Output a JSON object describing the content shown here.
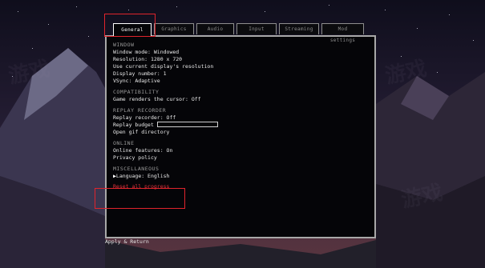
{
  "tabs": [
    {
      "label": "General",
      "active": true
    },
    {
      "label": "Graphics",
      "active": false
    },
    {
      "label": "Audio",
      "active": false
    },
    {
      "label": "Input",
      "active": false
    },
    {
      "label": "Streaming",
      "active": false
    },
    {
      "label": "Mod settings",
      "active": false
    }
  ],
  "window": {
    "heading": "WINDOW",
    "mode": "Window mode: Windowed",
    "resolution": "Resolution: 1280 x 720",
    "current_res": "Use current display's resolution",
    "display_number": "Display number: 1",
    "vsync": "VSync: Adaptive"
  },
  "compatibility": {
    "heading": "COMPATIBILITY",
    "cursor": "Game renders the cursor: Off"
  },
  "replay": {
    "heading": "REPLAY RECORDER",
    "recorder": "Replay recorder: Off",
    "budget_label": "Replay budget",
    "budget_level": 0,
    "open_dir": "Open gif directory"
  },
  "online": {
    "heading": "ONLINE",
    "features": "Online features: On",
    "privacy": "Privacy policy"
  },
  "misc": {
    "heading": "MISCELLANEOUS",
    "cursor_glyph": "▶",
    "language": "Language: English",
    "reset": "Reset all progress"
  },
  "footer": {
    "apply": "Apply & Return"
  },
  "colors": {
    "panel": "#050508",
    "border": "#a8a8a8",
    "reset": "#e0323a",
    "highlight": "#e0242c"
  }
}
